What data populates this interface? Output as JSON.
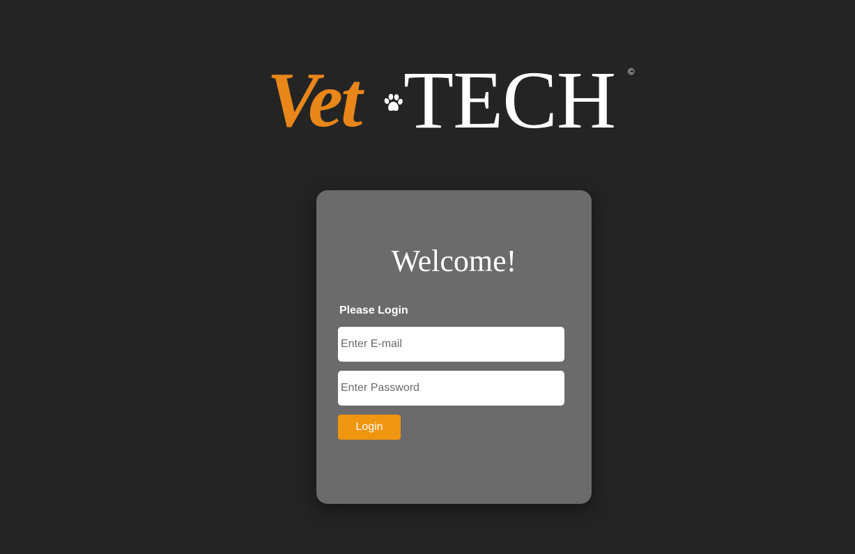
{
  "logo": {
    "vet_text": "Vet",
    "tech_text": "TECH",
    "copyright_symbol": "©",
    "paw_icon": "paw-icon",
    "accent_color": "#e8861a"
  },
  "card": {
    "title": "Welcome!",
    "subtitle": "Please Login",
    "email_placeholder": "Enter E-mail",
    "password_placeholder": "Enter Password",
    "login_label": "Login",
    "button_color": "#f0950f"
  }
}
